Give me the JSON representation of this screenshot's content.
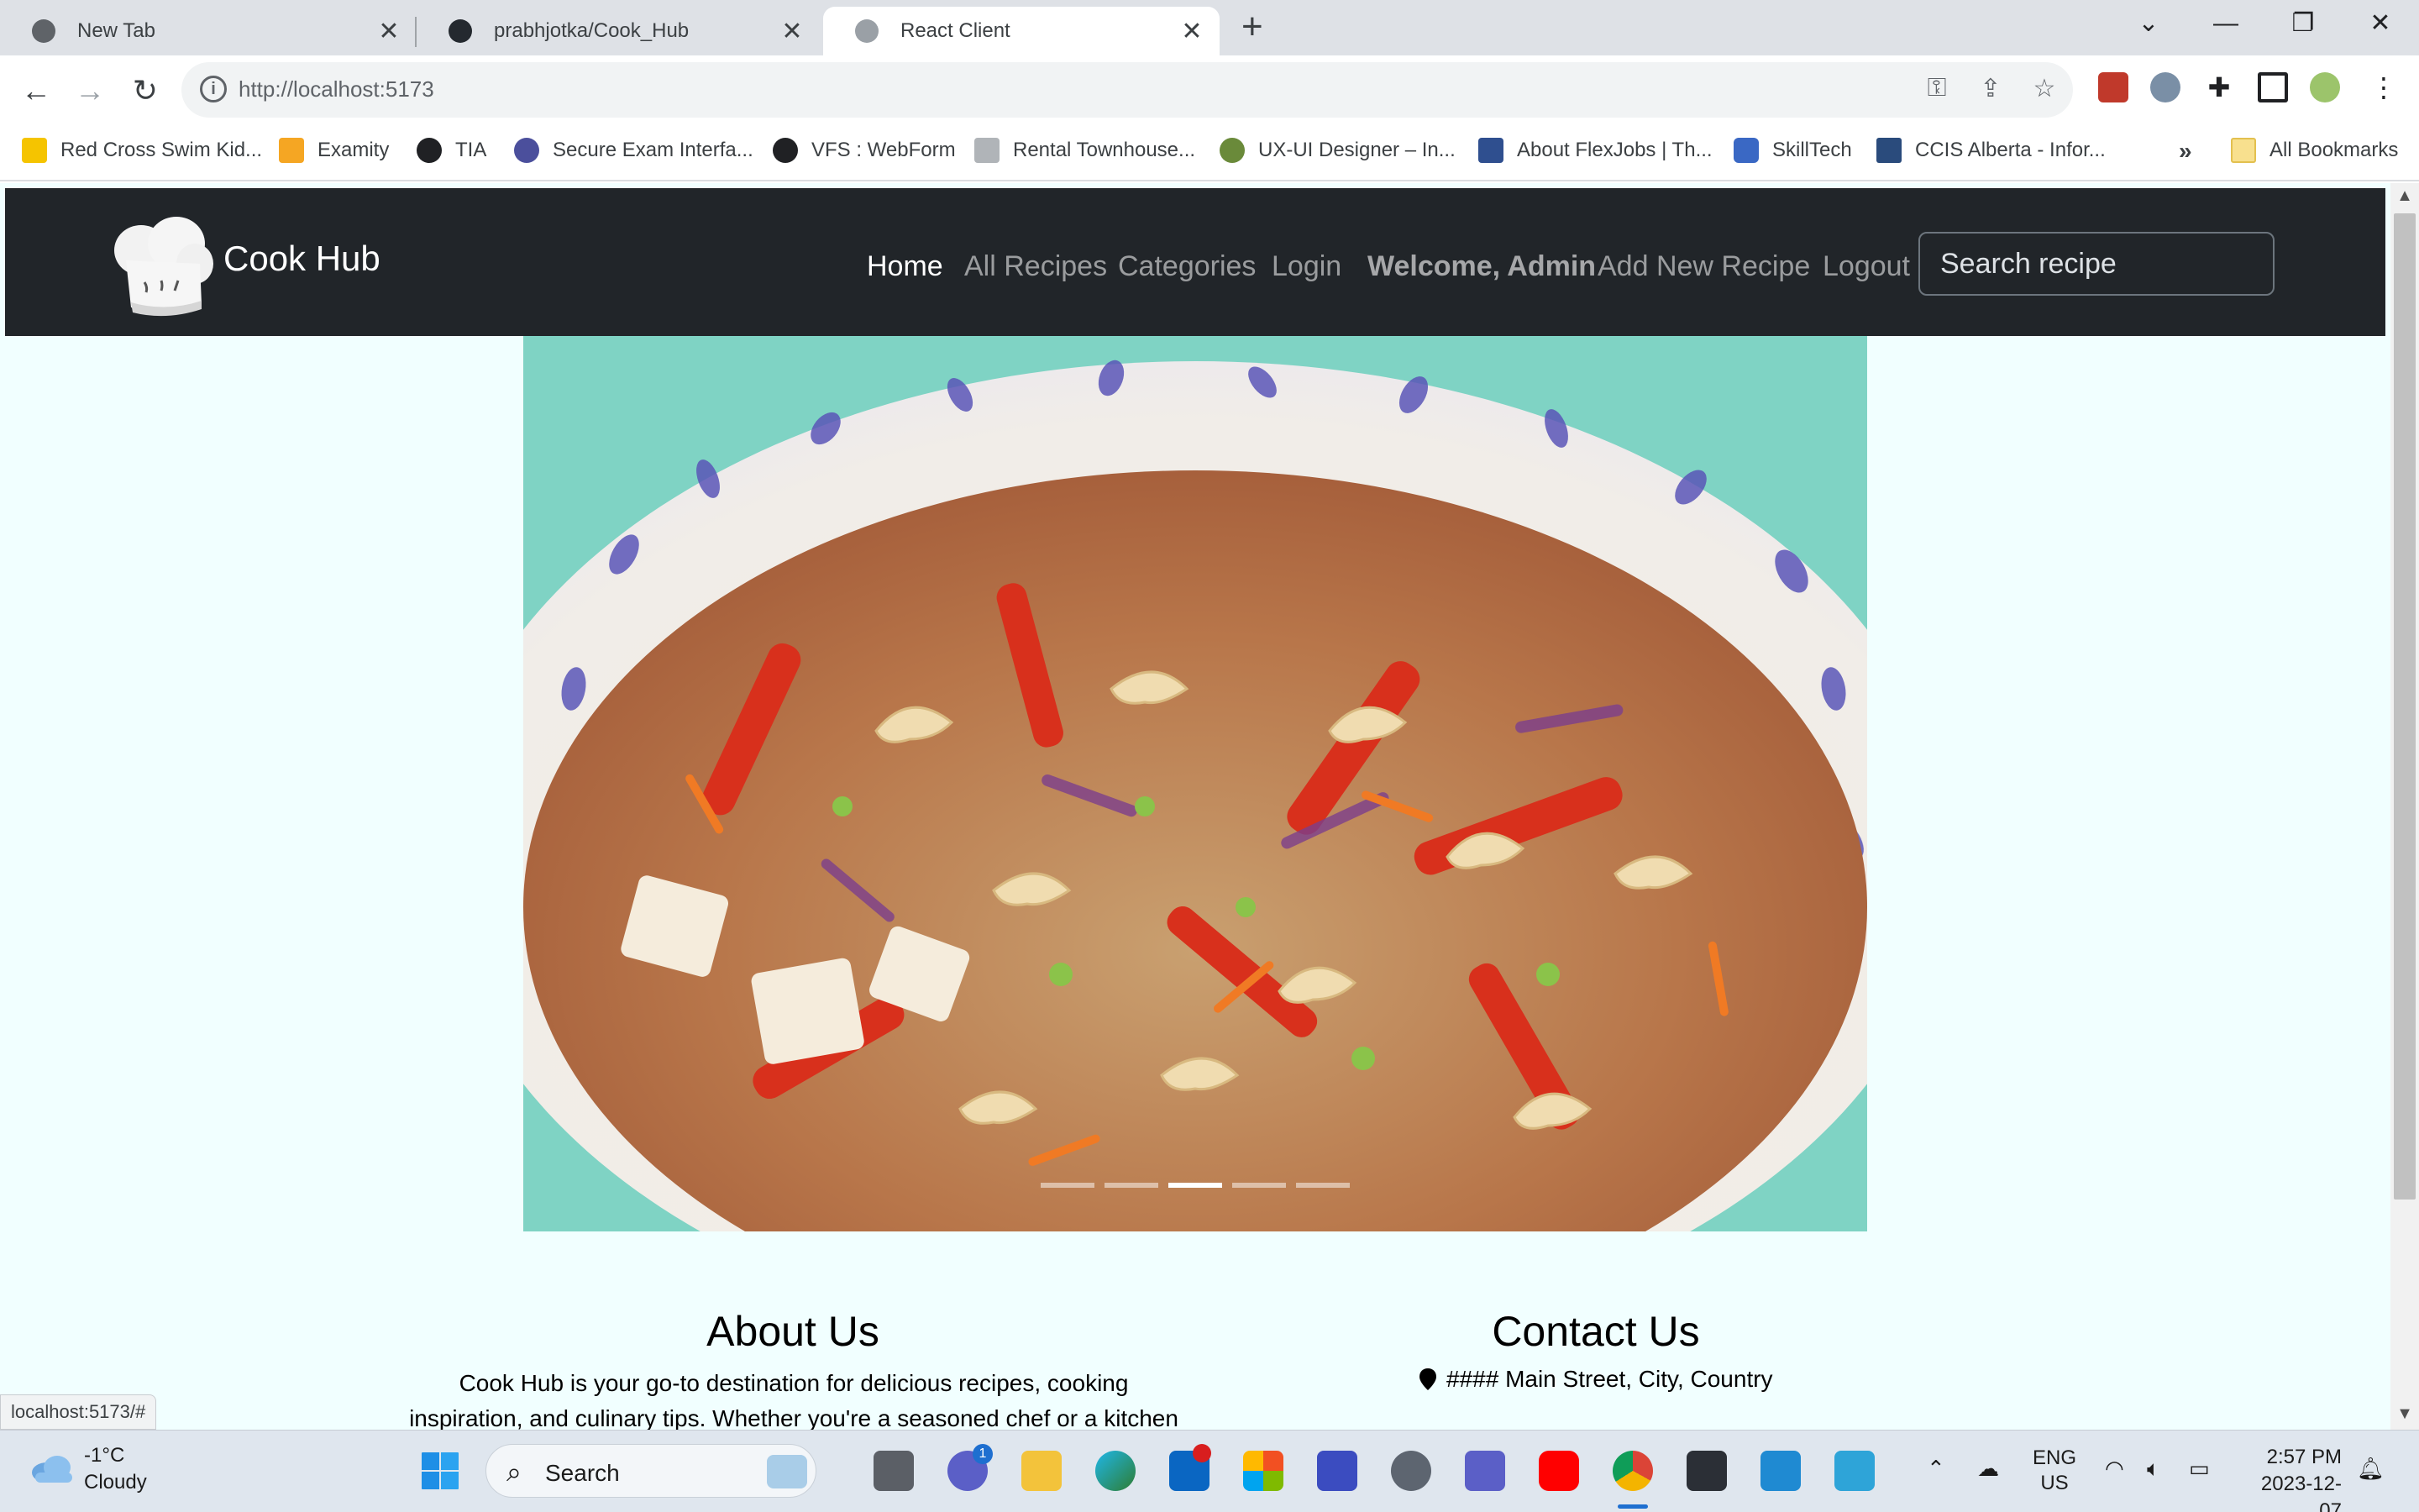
{
  "browser": {
    "tabs": [
      {
        "title": "New Tab",
        "active": false
      },
      {
        "title": "prabhjotka/Cook_Hub",
        "active": false
      },
      {
        "title": "React Client",
        "active": true
      }
    ],
    "new_tab_symbol": "+",
    "url": "http://localhost:5173",
    "bookmarks": [
      "Red Cross Swim Kid...",
      "Examity",
      "TIA",
      "Secure Exam Interfa...",
      "VFS : WebForm",
      "Rental Townhouse...",
      "UX-UI Designer – In...",
      "About FlexJobs | Th...",
      "SkillTech",
      "CCIS Alberta - Infor..."
    ],
    "overflow_symbol": "»",
    "all_bookmarks": "All Bookmarks",
    "status_url": "localhost:5173/#"
  },
  "site": {
    "brand": "Cook Hub",
    "nav": {
      "home": "Home",
      "all_recipes": "All Recipes",
      "categories": "Categories",
      "login": "Login",
      "welcome": "Welcome, Admin",
      "add_recipe": "Add New Recipe",
      "logout": "Logout"
    },
    "search_placeholder": "Search recipe",
    "carousel": {
      "slide_count": 5,
      "active_index": 2
    },
    "about": {
      "title": "About Us",
      "text": "Cook Hub is your go-to destination for delicious recipes, cooking inspiration, and culinary tips. Whether you're a seasoned chef or a kitchen"
    },
    "contact": {
      "title": "Contact Us",
      "address": "#### Main Street, City, Country"
    },
    "colors": {
      "navbar": "#212529",
      "page_bg": "#f1ffff"
    }
  },
  "taskbar": {
    "weather": {
      "temp": "-1°C",
      "condition": "Cloudy"
    },
    "search_label": "Search",
    "lang": {
      "line1": "ENG",
      "line2": "US"
    },
    "time": "2:57 PM",
    "date": "2023-12-07",
    "teams_badge": "1"
  }
}
